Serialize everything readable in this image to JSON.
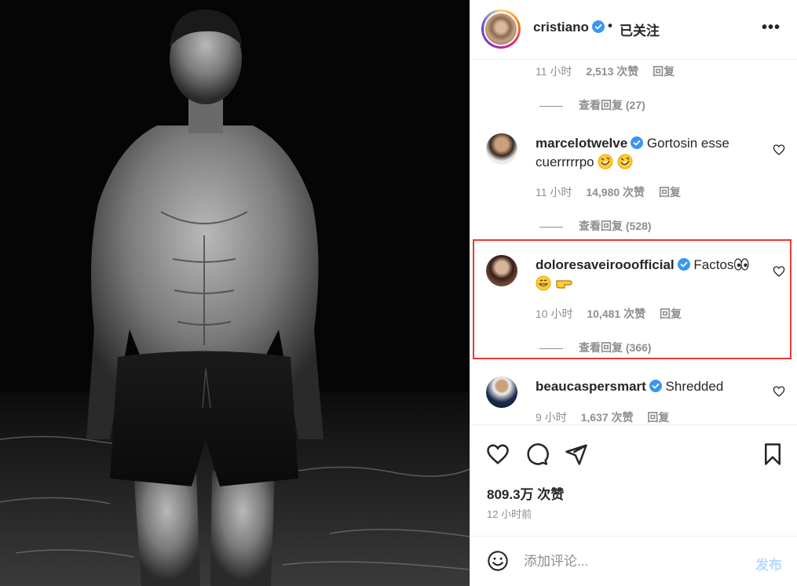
{
  "post": {
    "author": "cristiano",
    "separator": "•",
    "follow_status": "已关注",
    "more": "•••"
  },
  "comments": [
    {
      "partial": true,
      "time": "11 小时",
      "likes": "2,513 次赞",
      "reply": "回复",
      "view_replies": "查看回复 (27)"
    },
    {
      "user": "marcelotwelve",
      "verified": true,
      "text_line1": "Gortosin esse",
      "text_line2": "cuerrrrrpo",
      "emojis": [
        "rofl-emoji",
        "rofl-emoji"
      ],
      "time": "11 小时",
      "likes": "14,980 次赞",
      "reply": "回复",
      "view_replies": "查看回复 (528)"
    },
    {
      "user": "doloresaveirooofficial",
      "verified": true,
      "text_line1": "Factos",
      "emojis": [
        "eyes-emoji",
        "grin-emoji",
        "pointing-hand-emoji"
      ],
      "time": "10 小时",
      "likes": "10,481 次赞",
      "reply": "回复",
      "view_replies": "查看回复 (366)",
      "highlighted": true
    },
    {
      "user": "beaucaspersmart",
      "verified": true,
      "text_line1": "Shredded",
      "time": "9 小时",
      "likes": "1,637 次赞",
      "reply": "回复"
    }
  ],
  "actions": {
    "likes_count": "809.3万 次赞",
    "posted_time": "12 小时前"
  },
  "composer": {
    "placeholder": "添加评论...",
    "post_label": "发布"
  },
  "colors": {
    "verified": "#3897f0",
    "highlight_border": "#e53935",
    "muted_text": "#8e8e8e",
    "post_disabled": "#b3dbff"
  }
}
